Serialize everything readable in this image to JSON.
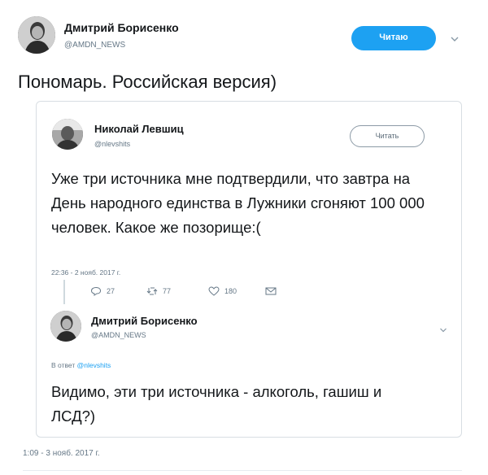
{
  "main_tweet": {
    "author_name": "Дмитрий Борисенко",
    "author_handle": "@AMDN_NEWS",
    "follow_label": "Читаю",
    "text": "Пономарь. Российская версия)",
    "timestamp": "1:09 - 3 нояб. 2017 г."
  },
  "quoted_tweet": {
    "author_name": "Николай Левшиц",
    "author_handle": "@nlevshits",
    "follow_label": "Читать",
    "text": "Уже три источника мне подтвердили, что завтра на День народного единства в Лужники сгоняют 100 000 человек. Какое же позорище:(",
    "timestamp": "22:36 - 2 нояб. 2017 г.",
    "actions": {
      "replies": "27",
      "retweets": "77",
      "likes": "180"
    }
  },
  "reply_tweet": {
    "author_name": "Дмитрий Борисенко",
    "author_handle": "@AMDN_NEWS",
    "reply_to_prefix": "В ответ",
    "reply_to_handle": "@nlevshits",
    "text": "Видимо, эти три источника - алкоголь, гашиш и ЛСД?)"
  },
  "colors": {
    "accent": "#1da1f2",
    "text": "#14171a",
    "secondary": "#657786"
  }
}
